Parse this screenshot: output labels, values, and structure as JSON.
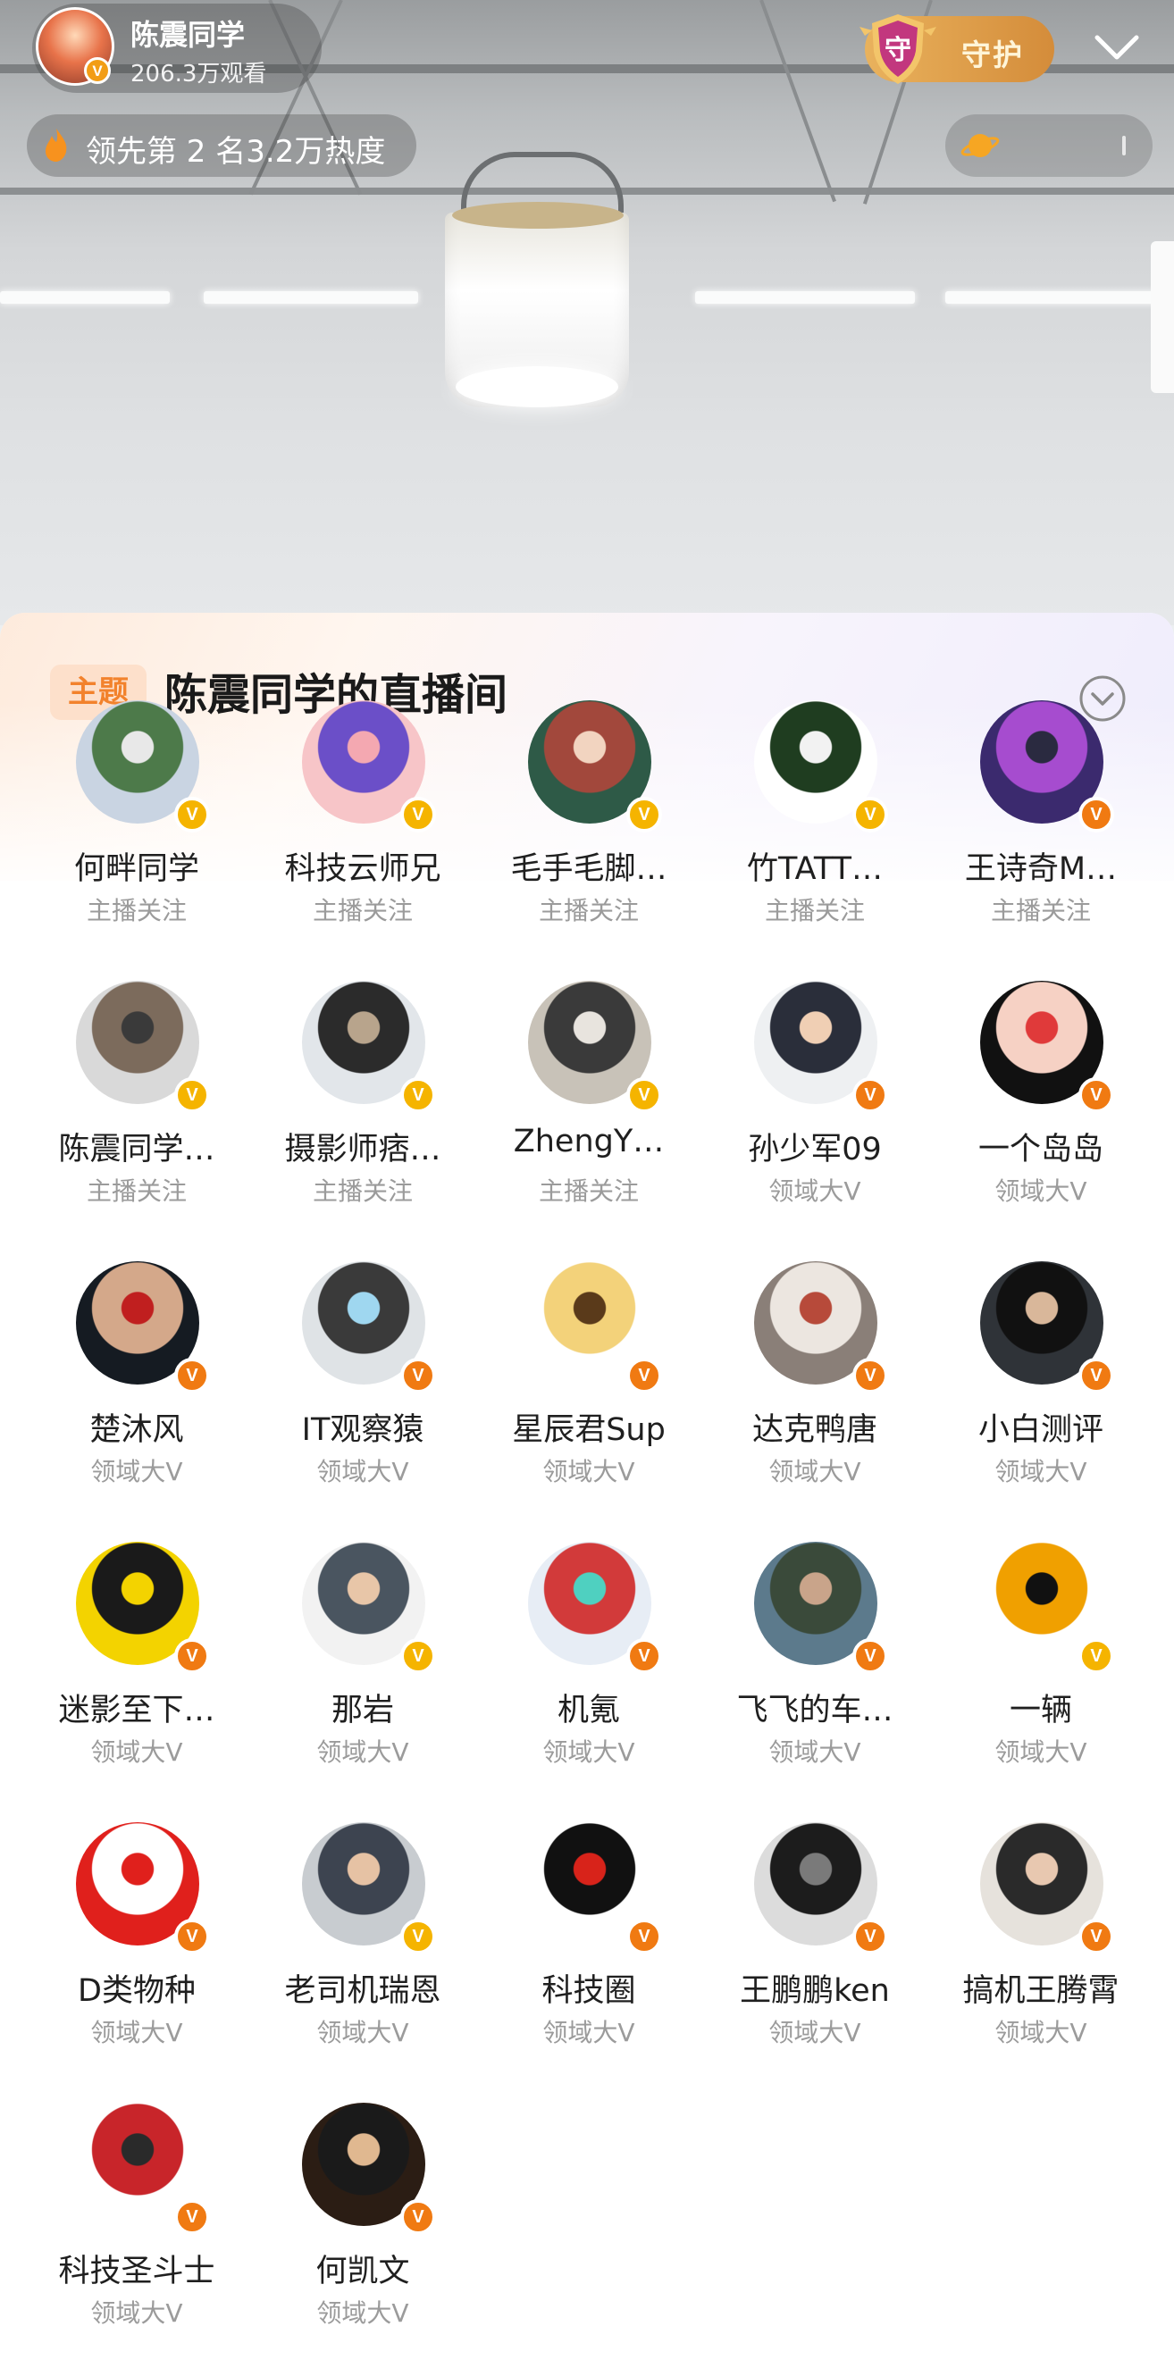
{
  "header": {
    "anchor_name": "陈震同学",
    "views": "206.3万观看",
    "guard_label": "守护",
    "guard_shield_char": "守",
    "heat_text": "领先第 2 名3.2万热度",
    "v_mark": "V"
  },
  "sheet": {
    "topic_tag": "主题",
    "title": "陈震同学的直播间"
  },
  "colors": {
    "accent_orange": "#f07a12",
    "badge_yellow": "#f5b400",
    "topic_tag_bg": "#fde0cb",
    "topic_tag_text": "#f2822c",
    "guard_gold": "#e9b25d"
  },
  "users": [
    {
      "name": "何畔同学",
      "tag": "主播关注",
      "badge": "y",
      "avatar": [
        "#c9d4e2",
        "#4d7a4a",
        "#e8e8e8"
      ]
    },
    {
      "name": "科技云师兄",
      "tag": "主播关注",
      "badge": "y",
      "avatar": [
        "#f7c5c8",
        "#6b4fc8",
        "#f4a8b1"
      ]
    },
    {
      "name": "毛手毛脚…",
      "tag": "主播关注",
      "badge": "y",
      "avatar": [
        "#2e5a47",
        "#a2483c",
        "#f2d4c0"
      ]
    },
    {
      "name": "竹TATT…",
      "tag": "主播关注",
      "badge": "y",
      "avatar": [
        "#ffffff",
        "#1f3d20",
        "#f2f2f2"
      ]
    },
    {
      "name": "王诗奇M…",
      "tag": "主播关注",
      "badge": "o",
      "avatar": [
        "#3b2a6e",
        "#a64ccf",
        "#2a2a40"
      ]
    },
    {
      "name": "陈震同学…",
      "tag": "主播关注",
      "badge": "y",
      "avatar": [
        "#d9d9d9",
        "#7c6b5c",
        "#3a3a3a"
      ]
    },
    {
      "name": "摄影师痞…",
      "tag": "主播关注",
      "badge": "y",
      "avatar": [
        "#e2e6ea",
        "#2b2b2b",
        "#b8a48c"
      ]
    },
    {
      "name": "ZhengY…",
      "tag": "主播关注",
      "badge": "y",
      "avatar": [
        "#c8c2b8",
        "#3a3a3a",
        "#e8e4de"
      ]
    },
    {
      "name": "孙少军09",
      "tag": "领域大V",
      "badge": "o",
      "avatar": [
        "#eef0f2",
        "#2a2e3a",
        "#f0cfb4"
      ]
    },
    {
      "name": "一个岛岛",
      "tag": "领域大V",
      "badge": "o",
      "avatar": [
        "#111111",
        "#f6d1c4",
        "#e03a3a"
      ]
    },
    {
      "name": "楚沐风",
      "tag": "领域大V",
      "badge": "o",
      "avatar": [
        "#151b22",
        "#d4a88a",
        "#c01f1f"
      ]
    },
    {
      "name": "IT观察猿",
      "tag": "领域大V",
      "badge": "o",
      "avatar": [
        "#dfe3e6",
        "#3a3a3a",
        "#9fd7f0"
      ]
    },
    {
      "name": "星辰君Sup",
      "tag": "领域大V",
      "badge": "o",
      "avatar": [
        "#ffffff",
        "#f3d27a",
        "#5a3a1a"
      ]
    },
    {
      "name": "达克鸭唐",
      "tag": "领域大V",
      "badge": "o",
      "avatar": [
        "#8a7f78",
        "#ece6e0",
        "#b74a3a"
      ]
    },
    {
      "name": "小白测评",
      "tag": "领域大V",
      "badge": "o",
      "avatar": [
        "#2f3338",
        "#111111",
        "#d9b79a"
      ]
    },
    {
      "name": "迷影至下…",
      "tag": "领域大V",
      "badge": "o",
      "avatar": [
        "#f3d300",
        "#1a1a1a",
        "#f3d300"
      ]
    },
    {
      "name": "那岩",
      "tag": "领域大V",
      "badge": "y",
      "avatar": [
        "#f2f2f2",
        "#4a5560",
        "#e8c6a8"
      ]
    },
    {
      "name": "机氪",
      "tag": "领域大V",
      "badge": "o",
      "avatar": [
        "#e7edf5",
        "#d23a3a",
        "#4fd0c0"
      ]
    },
    {
      "name": "飞飞的车…",
      "tag": "领域大V",
      "badge": "o",
      "avatar": [
        "#5c7a8c",
        "#3a4a3a",
        "#c9a48a"
      ]
    },
    {
      "name": "一辆",
      "tag": "领域大V",
      "badge": "y",
      "avatar": [
        "#ffffff",
        "#f0a000",
        "#111111"
      ]
    },
    {
      "name": "D类物种",
      "tag": "领域大V",
      "badge": "o",
      "avatar": [
        "#e0201c",
        "#ffffff",
        "#e0201c"
      ]
    },
    {
      "name": "老司机瑞恩",
      "tag": "领域大V",
      "badge": "y",
      "avatar": [
        "#c8ccd0",
        "#3d4450",
        "#e6c2a4"
      ]
    },
    {
      "name": "科技圈",
      "tag": "领域大V",
      "badge": "o",
      "avatar": [
        "#ffffff",
        "#111111",
        "#d8231a"
      ]
    },
    {
      "name": "王鹏鹏ken",
      "tag": "领域大V",
      "badge": "o",
      "avatar": [
        "#dcdcdc",
        "#1c1c1c",
        "#7a7a7a"
      ]
    },
    {
      "name": "搞机王腾霄",
      "tag": "领域大V",
      "badge": "o",
      "avatar": [
        "#e6e2dc",
        "#2a2a2a",
        "#e8c8b0"
      ]
    },
    {
      "name": "科技圣斗士",
      "tag": "领域大V",
      "badge": "o",
      "avatar": [
        "#ffffff",
        "#c8252a",
        "#2a2a2a"
      ]
    },
    {
      "name": "何凯文",
      "tag": "领域大V",
      "badge": "o",
      "avatar": [
        "#2b1d14",
        "#1a1a1a",
        "#e0b890"
      ]
    }
  ]
}
